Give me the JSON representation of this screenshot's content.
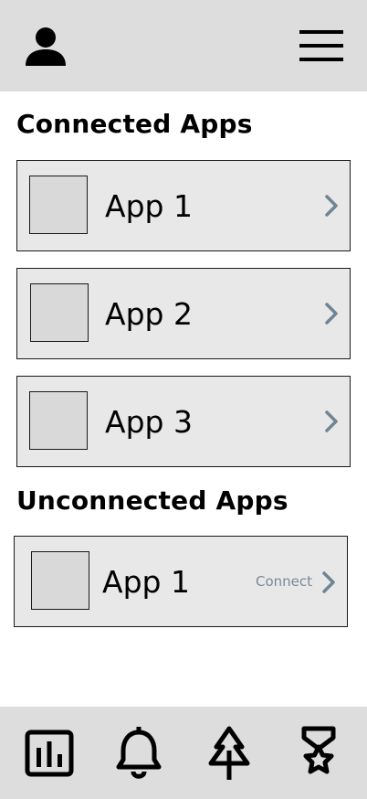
{
  "header": {
    "profile_icon": "person-icon",
    "menu_icon": "hamburger-menu-icon"
  },
  "sections": {
    "connected_title": "Connected Apps",
    "unconnected_title": "Unconnected Apps"
  },
  "connected_apps": [
    {
      "name": "App 1"
    },
    {
      "name": "App 2"
    },
    {
      "name": "App 3"
    }
  ],
  "unconnected_apps": [
    {
      "name": "App 1",
      "action_label": "Connect"
    }
  ],
  "bottom_nav": {
    "items": [
      "bar-chart-icon",
      "bell-icon",
      "tree-icon",
      "award-icon"
    ]
  },
  "colors": {
    "header_bg": "#dddddd",
    "row_bg": "#e8e8e8",
    "thumb_bg": "#d9d9d9",
    "chevron": "#6e8593",
    "connect_text": "#7a8a96"
  }
}
